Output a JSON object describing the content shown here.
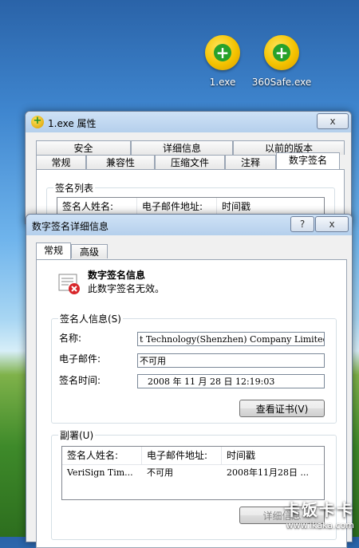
{
  "desktop": {
    "icons": [
      {
        "label": "1.exe"
      },
      {
        "label": "360Safe.exe"
      }
    ]
  },
  "props_window": {
    "title": "1.exe 属性",
    "close_label": "x",
    "tabs_top": [
      "安全",
      "详细信息",
      "以前的版本"
    ],
    "tabs_bottom": [
      "常规",
      "兼容性",
      "压缩文件",
      "注释",
      "数字签名"
    ],
    "group_label": "签名列表",
    "columns": [
      "签名人姓名:",
      "电子邮件地址:",
      "时间戳"
    ]
  },
  "detail_window": {
    "title": "数字签名详细信息",
    "help_label": "?",
    "close_label": "x",
    "tabs": [
      "常规",
      "高级"
    ],
    "info_title": "数字签名信息",
    "info_status": "此数字签名无效。",
    "signer_group_label": "签名人信息(S)",
    "name_label": "名称:",
    "name_value": "t Technology(Shenzhen) Company Limited",
    "email_label": "电子邮件:",
    "email_value": "不可用",
    "time_label": "签名时间:",
    "time_value": "2008  年  11  月  28  日  12:19:03",
    "view_cert_button": "查看证书(V)",
    "countersig_group_label": "副署(U)",
    "columns": [
      "签名人姓名:",
      "电子邮件地址:",
      "时间戳"
    ],
    "rows": [
      {
        "name": "VeriSign Tim...",
        "email": "不可用",
        "timestamp": "2008年11月28日 ..."
      }
    ],
    "details_button": "详细信息"
  },
  "watermark": {
    "brand": "卡饭卡卡",
    "url": "www.ikaka.com"
  }
}
